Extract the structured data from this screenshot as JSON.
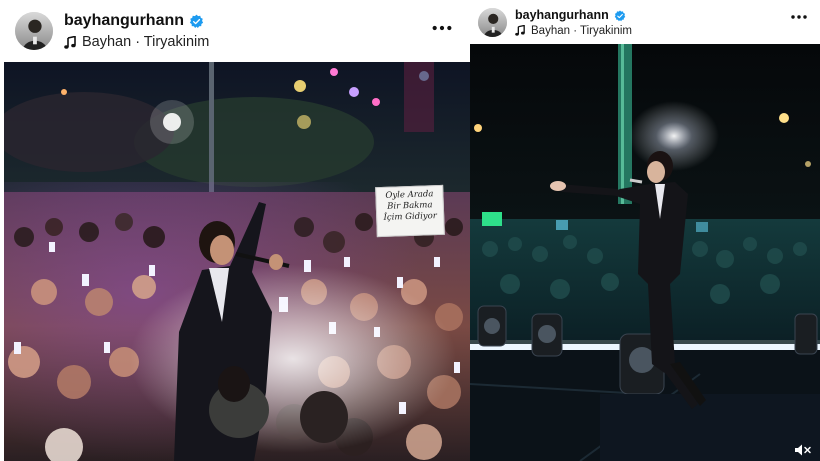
{
  "posts": [
    {
      "username": "bayhangurhann",
      "audio": "Bayhan · Tiryakinim",
      "sign_text": "Oyle Arada Bir Bakma İçim Gidiyor"
    },
    {
      "username": "bayhangurhann",
      "audio": "Bayhan · Tiryakinim"
    }
  ],
  "colors": {
    "verified_badge": "#1d9bf0",
    "crowd_stage_light": "#f2f2ff",
    "stage_green": "#2ee08a"
  },
  "icons": [
    "verified-badge-icon",
    "music-note-icon",
    "more-options-icon",
    "muted-speaker-icon"
  ]
}
